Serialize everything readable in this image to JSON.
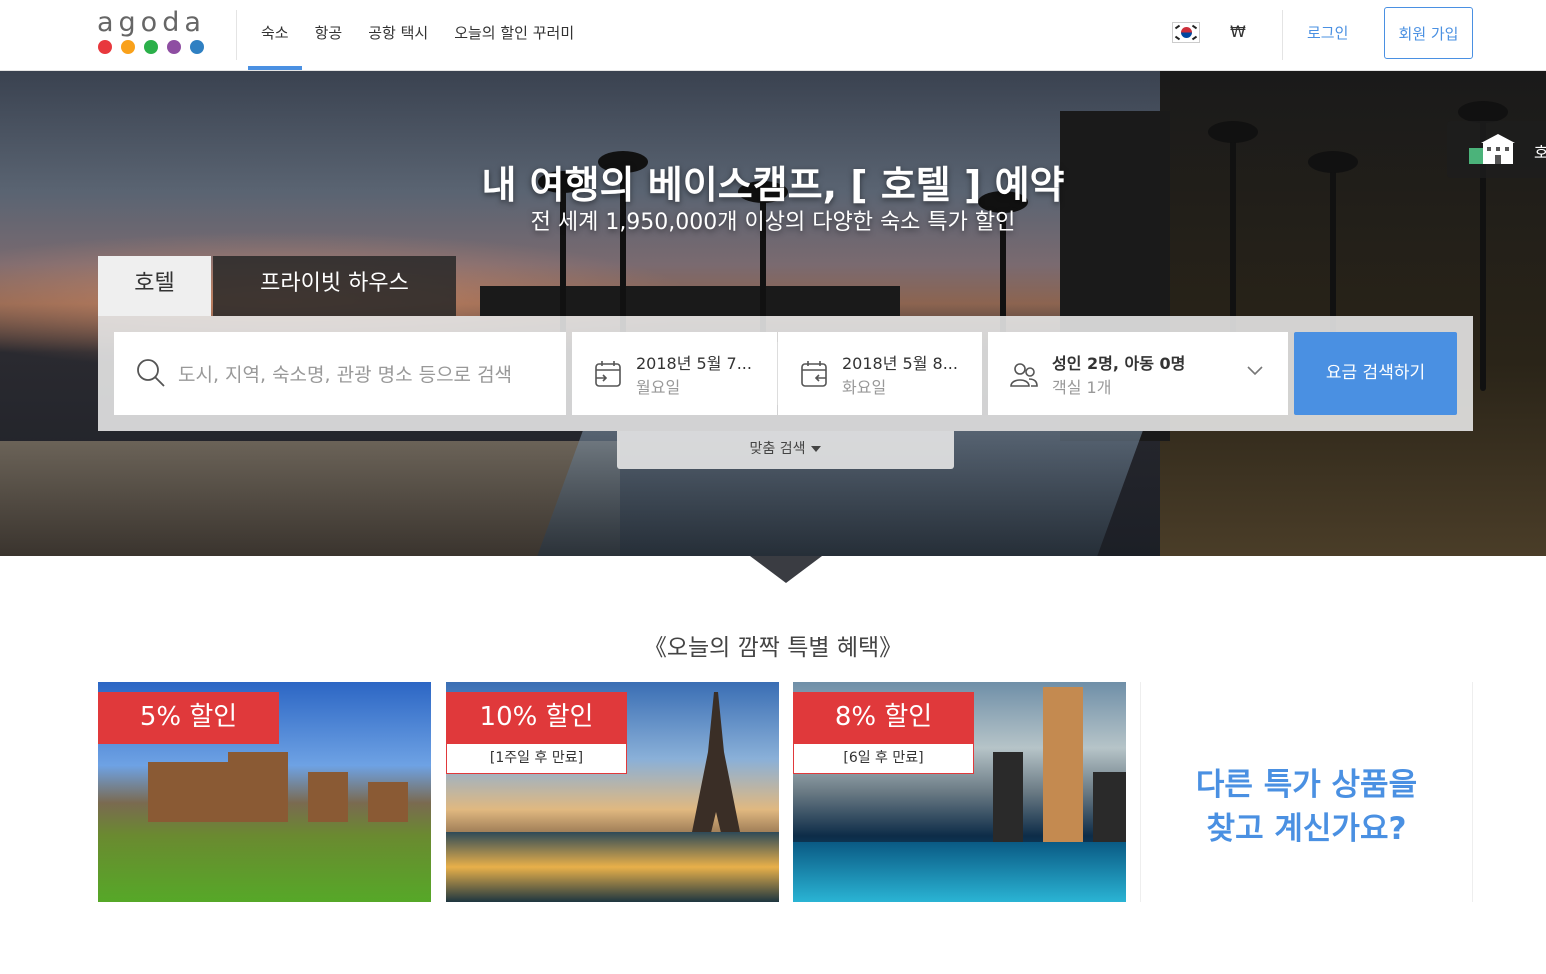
{
  "logo": {
    "text": "agoda",
    "dots": [
      "#e8383d",
      "#f9a11b",
      "#2bb04a",
      "#8e4ea2",
      "#2f80c2"
    ]
  },
  "nav": {
    "items": [
      {
        "label": "숙소",
        "active": true
      },
      {
        "label": "항공",
        "active": false
      },
      {
        "label": "공항 택시",
        "active": false
      },
      {
        "label": "오늘의 할인 꾸러미",
        "active": false
      }
    ]
  },
  "header_right": {
    "currency": "₩",
    "login_label": "로그인",
    "signup_label": "회원 가입"
  },
  "hero": {
    "title": "내 여행의 베이스캠프, [ 호텔 ] 예약",
    "subtitle": "전 세계 1,950,000개 이상의 다양한 숙소 특가 할인",
    "badge_text": "호"
  },
  "tabs": {
    "hotel": "호텔",
    "private_house": "프라이빗 하우스"
  },
  "search": {
    "destination_placeholder": "도시, 지역, 숙소명, 관광 명소 등으로 검색",
    "checkin_date": "2018년 5월 7...",
    "checkin_day": "월요일",
    "checkout_date": "2018년 5월 8...",
    "checkout_day": "화요일",
    "occupancy": "성인 2명, 아동 0명",
    "rooms": "객실 1개",
    "button_label": "요금 검색하기",
    "custom_search_label": "맞춤 검색"
  },
  "deals": {
    "section_title": "《오늘의 깜짝 특별 혜택》",
    "cards": [
      {
        "discount": "5% 할인",
        "expiry": ""
      },
      {
        "discount": "10% 할인",
        "expiry": "[1주일 후 만료]"
      },
      {
        "discount": "8% 할인",
        "expiry": "[6일 후 만료]"
      }
    ],
    "more_text": "다른 특가 상품을 찾고 계신가요?"
  },
  "colors": {
    "accent": "#4a90e2",
    "discount_red": "#e0393b"
  }
}
